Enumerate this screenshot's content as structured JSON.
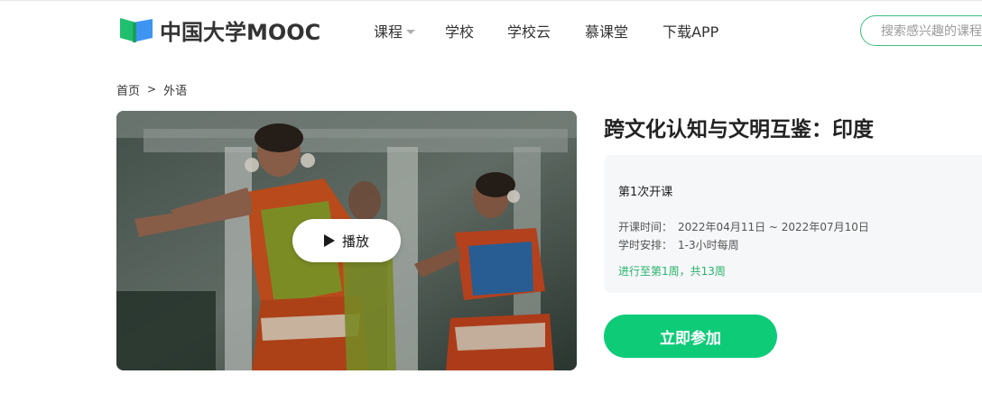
{
  "header": {
    "logo_text": "中国大学MOOC",
    "nav": [
      {
        "label": "课程",
        "has_dropdown": true
      },
      {
        "label": "学校"
      },
      {
        "label": "学校云"
      },
      {
        "label": "慕课堂"
      },
      {
        "label": "下载APP"
      }
    ],
    "search_placeholder": "搜索感兴趣的课程"
  },
  "breadcrumb": {
    "home": "首页",
    "separator": ">",
    "current": "外语"
  },
  "video": {
    "play_label": "播放"
  },
  "course": {
    "title": "跨文化认知与文明互鉴：印度",
    "term": "第1次开课",
    "schedule_label": "开课时间：",
    "schedule_value": "2022年04月11日 ~ 2022年07月10日",
    "hours_label": "学时安排：",
    "hours_value": "1-3小时每周",
    "progress": "进行至第1周，共13周",
    "join_label": "立即参加"
  },
  "colors": {
    "brand_green": "#0ecb78",
    "progress_green": "#27b36a",
    "search_border": "#3fbf7f",
    "card_bg": "#f6f7f9"
  }
}
